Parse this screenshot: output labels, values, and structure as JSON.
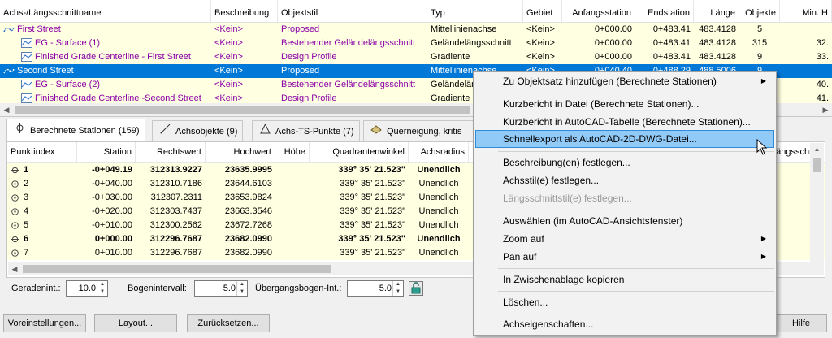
{
  "top_grid": {
    "columns": [
      "Achs-/Längsschnittname",
      "Beschreibung",
      "Objektstil",
      "Typ",
      "Gebiet",
      "Anfangsstation",
      "Endstation",
      "Länge",
      "Objekte",
      "Min. H"
    ],
    "rows": [
      {
        "name": "First Street",
        "desc": "<Kein>",
        "style": "Proposed",
        "type": "Mittellinienachse",
        "site": "<Kein>",
        "start": "0+000.00",
        "end": "0+483.41",
        "len": "483.4128",
        "obj": "5",
        "minh": ""
      },
      {
        "name": "EG - Surface (1)",
        "desc": "<Kein>",
        "style": "Bestehender Geländelängsschnitt",
        "type": "Geländelängsschnitt",
        "site": "<Kein>",
        "start": "0+000.00",
        "end": "0+483.41",
        "len": "483.4128",
        "obj": "315",
        "minh": "32."
      },
      {
        "name": "Finished Grade Centerline - First Street",
        "desc": "<Kein>",
        "style": "Design Profile",
        "type": "Gradiente",
        "site": "<Kein>",
        "start": "0+000.00",
        "end": "0+483.41",
        "len": "483.4128",
        "obj": "9",
        "minh": "33."
      },
      {
        "name": "Second Street",
        "desc": "<Kein>",
        "style": "Proposed",
        "type": "Mittellinienachse",
        "site": "<Kein>",
        "start": "0+040.40",
        "end": "0+488.29",
        "len": "488.5006",
        "obj": "9",
        "minh": ""
      },
      {
        "name": "EG - Surface (2)",
        "desc": "<Kein>",
        "style": "Bestehender Geländelängsschnitt",
        "type": "Geländelängsschnitt",
        "site": "",
        "start": "",
        "end": "",
        "len": "",
        "obj": "",
        "minh": "40."
      },
      {
        "name": "Finished Grade Centerline -Second Street",
        "desc": "<Kein>",
        "style": "Design Profile",
        "type": "Gradiente",
        "site": "",
        "start": "",
        "end": "",
        "len": "",
        "obj": "",
        "minh": "41."
      }
    ]
  },
  "tabs": [
    {
      "label": "Berechnete Stationen (159)",
      "icon": "crosshair-icon"
    },
    {
      "label": "Achsobjekte (9)",
      "icon": "line-segment-icon"
    },
    {
      "label": "Achs-TS-Punkte (7)",
      "icon": "triangle-icon"
    },
    {
      "label": "Querneigung, kritis",
      "icon": "superelevation-icon"
    }
  ],
  "bottom_grid": {
    "columns": [
      "Punktindex",
      "Station",
      "Rechtswert",
      "Hochwert",
      "Höhe",
      "Quadrantenwinkel",
      "Achsradius",
      "Längsschr"
    ],
    "rows": [
      {
        "idx": "1",
        "station": "-0+049.19",
        "rw": "312313.9227",
        "hw": "23635.9995",
        "h": "",
        "qw": "339° 35' 21.523\"",
        "rad": "Unendlich",
        "bold": true,
        "major": true
      },
      {
        "idx": "2",
        "station": "-0+040.00",
        "rw": "312310.7186",
        "hw": "23644.6103",
        "h": "",
        "qw": "339° 35' 21.523\"",
        "rad": "Unendlich",
        "bold": false,
        "major": false
      },
      {
        "idx": "3",
        "station": "-0+030.00",
        "rw": "312307.2311",
        "hw": "23653.9824",
        "h": "",
        "qw": "339° 35' 21.523\"",
        "rad": "Unendlich",
        "bold": false,
        "major": false
      },
      {
        "idx": "4",
        "station": "-0+020.00",
        "rw": "312303.7437",
        "hw": "23663.3546",
        "h": "",
        "qw": "339° 35' 21.523\"",
        "rad": "Unendlich",
        "bold": false,
        "major": false
      },
      {
        "idx": "5",
        "station": "-0+010.00",
        "rw": "312300.2562",
        "hw": "23672.7268",
        "h": "",
        "qw": "339° 35' 21.523\"",
        "rad": "Unendlich",
        "bold": false,
        "major": false
      },
      {
        "idx": "6",
        "station": "0+000.00",
        "rw": "312296.7687",
        "hw": "23682.0990",
        "h": "",
        "qw": "339° 35' 21.523\"",
        "rad": "Unendlich",
        "bold": true,
        "major": true
      },
      {
        "idx": "7",
        "station": "0+010.00",
        "rw": "312296.7687",
        "hw": "23682.0990",
        "h": "",
        "qw": "339° 35' 21.523\"",
        "rad": "Unendlich",
        "bold": false,
        "major": false
      }
    ]
  },
  "inputs": {
    "gerade_label": "Geradenint.:",
    "gerade_value": "10.0",
    "bogen_label": "Bogenintervall:",
    "bogen_value": "5.0",
    "uebergang_label": "Übergangsbogen-Int.:",
    "uebergang_value": "5.0"
  },
  "footer": {
    "settings": "Voreinstellungen...",
    "layout": "Layout...",
    "reset": "Zurücksetzen...",
    "help": "Hilfe"
  },
  "context_menu": {
    "items": [
      {
        "label": "Zu Objektsatz hinzufügen (Berechnete Stationen)",
        "submenu": true
      },
      {
        "label": "Kurzbericht in Datei (Berechnete Stationen)..."
      },
      {
        "label": "Kurzbericht in AutoCAD-Tabelle (Berechnete Stationen)..."
      },
      {
        "label": "Schnellexport als AutoCAD-2D-DWG-Datei...",
        "highlighted": true
      },
      {
        "label": "Beschreibung(en) festlegen..."
      },
      {
        "label": "Achsstil(e) festlegen..."
      },
      {
        "label": "Längsschnittstil(e) festlegen...",
        "disabled": true
      },
      {
        "label": "Auswählen (im AutoCAD-Ansichtsfenster)"
      },
      {
        "label": "Zoom auf",
        "submenu": true
      },
      {
        "label": "Pan auf",
        "submenu": true
      },
      {
        "label": "In Zwischenablage kopieren"
      },
      {
        "label": "Löschen..."
      },
      {
        "label": "Achseigenschaften..."
      }
    ]
  },
  "colors": {
    "selection": "#0078d7",
    "highlight_row": "#ffffe1",
    "link_purple": "#8b00a8",
    "menu_highlight": "#91c9f7"
  }
}
